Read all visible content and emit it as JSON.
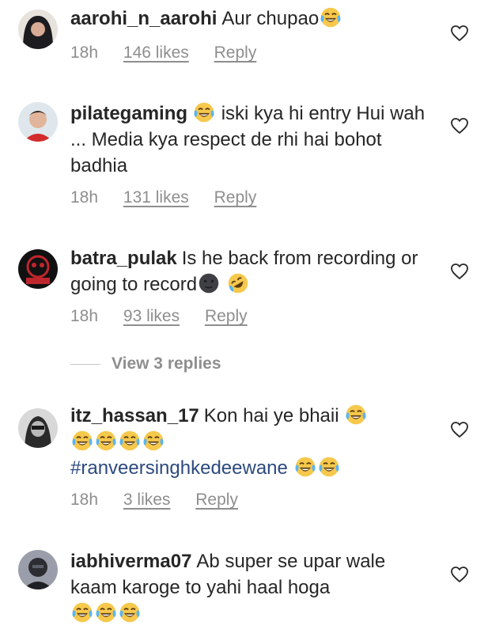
{
  "comments": [
    {
      "username": "aarohi_n_aarohi",
      "text": "Aur chupao",
      "time": "18h",
      "likes": "146 likes",
      "reply": "Reply",
      "avatar": "avatar-dark-hair"
    },
    {
      "username": "pilategaming",
      "text_a": "iski kya hi entry Hui wah ... Media kya respect de rhi hai bohot badhia",
      "time": "18h",
      "likes": "131 likes",
      "reply": "Reply",
      "avatar": "avatar-boy-red-shirt"
    },
    {
      "username": "batra_pulak",
      "text": "Is he back from recording or going to record",
      "time": "18h",
      "likes": "93 likes",
      "reply": "Reply",
      "avatar": "avatar-skull-logo"
    },
    {
      "username": "itz_hassan_17",
      "text": "Kon hai ye bhaii",
      "hashtag": "#ranveersinghkedeewane",
      "time": "18h",
      "likes": "3 likes",
      "reply": "Reply",
      "avatar": "avatar-hooded-man"
    },
    {
      "username": "iabhiverma07",
      "text": "Ab super se upar wale kaam karoge to yahi haal hoga",
      "avatar": "avatar-dark-person"
    }
  ],
  "view_replies": "View 3 replies",
  "icons": {
    "like": "heart-outline-icon",
    "emoji_laugh": "tears-of-joy-emoji",
    "emoji_rofl": "rolling-laughing-emoji",
    "emoji_moon": "new-moon-face-emoji"
  },
  "colors": {
    "text": "#262626",
    "meta": "#8e8e8e",
    "hashtag": "#2c4a7e"
  }
}
